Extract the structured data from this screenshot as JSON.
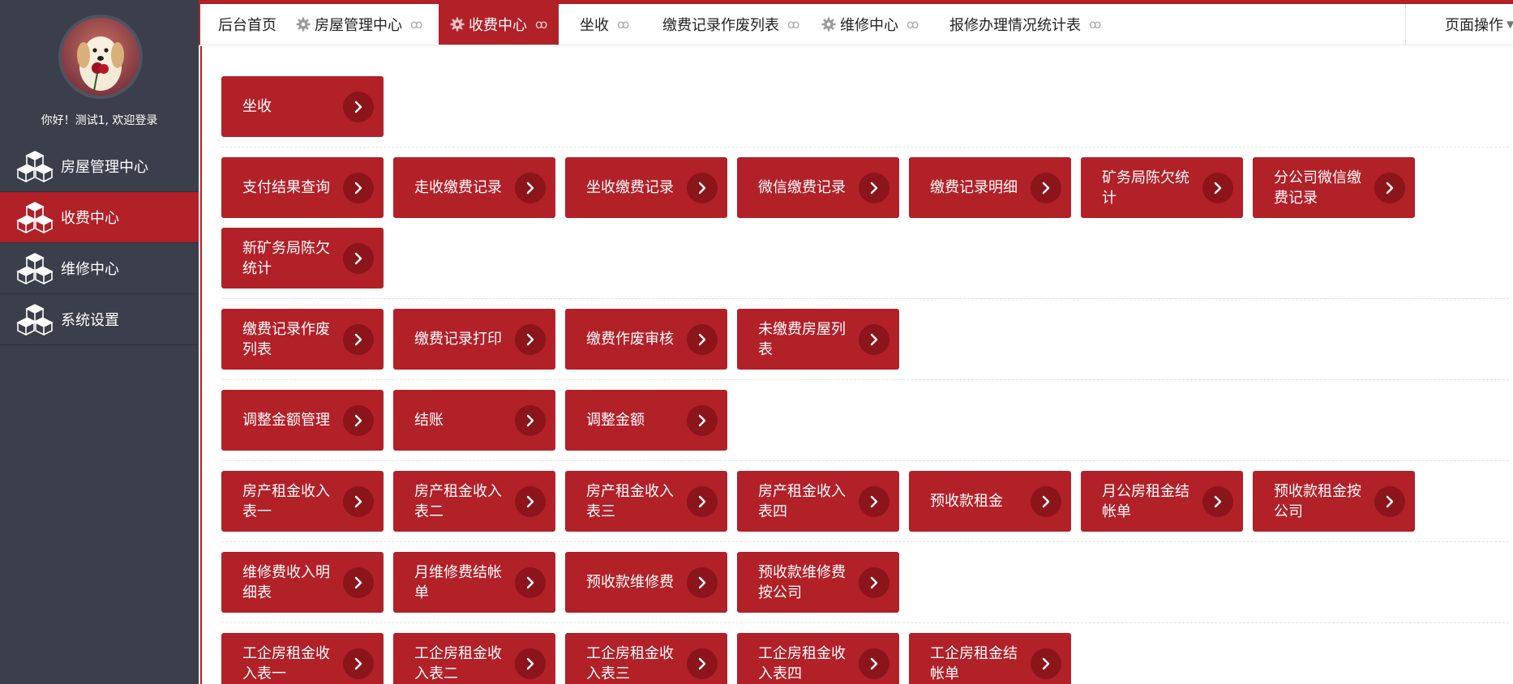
{
  "sidebar": {
    "greeting": "你好！测试1, 欢迎登录",
    "menu": [
      {
        "label": "房屋管理中心",
        "active": false
      },
      {
        "label": "收费中心",
        "active": true
      },
      {
        "label": "维修中心",
        "active": false
      },
      {
        "label": "系统设置",
        "active": false
      }
    ]
  },
  "tabs": [
    {
      "label": "后台首页",
      "gear": false,
      "close": false,
      "active": false
    },
    {
      "label": "房屋管理中心",
      "gear": true,
      "close": true,
      "active": false
    },
    {
      "label": "收费中心",
      "gear": true,
      "close": true,
      "active": true
    },
    {
      "label": "坐收",
      "gear": false,
      "close": true,
      "active": false
    },
    {
      "label": "缴费记录作废列表",
      "gear": false,
      "close": true,
      "active": false
    },
    {
      "label": "维修中心",
      "gear": true,
      "close": true,
      "active": false
    },
    {
      "label": "报修办理情况统计表",
      "gear": false,
      "close": true,
      "active": false
    }
  ],
  "tab_close_glyph": "ꝏ",
  "page_ops": "页面操作",
  "groups": [
    [
      "坐收"
    ],
    [
      "支付结果查询",
      "走收缴费记录",
      "坐收缴费记录",
      "微信缴费记录",
      "缴费记录明细",
      "矿务局陈欠统计",
      "分公司微信缴费记录",
      "新矿务局陈欠统计"
    ],
    [
      "缴费记录作废列表",
      "缴费记录打印",
      "缴费作废审核",
      "未缴费房屋列表"
    ],
    [
      "调整金额管理",
      "结账",
      "调整金额"
    ],
    [
      "房产租金收入表一",
      "房产租金收入表二",
      "房产租金收入表三",
      "房产租金收入表四",
      "预收款租金",
      "月公房租金结帐单",
      "预收款租金按公司"
    ],
    [
      "维修费收入明细表",
      "月维修费结帐单",
      "预收款维修费",
      "预收款维修费按公司"
    ],
    [
      "工企房租金收入表一",
      "工企房租金收入表二",
      "工企房租金收入表三",
      "工企房租金收入表四",
      "工企房租金结帐单"
    ]
  ],
  "colors": {
    "accent": "#b22028",
    "sidebar": "#3b3f4b",
    "arrow_bg": "#8c141b"
  }
}
